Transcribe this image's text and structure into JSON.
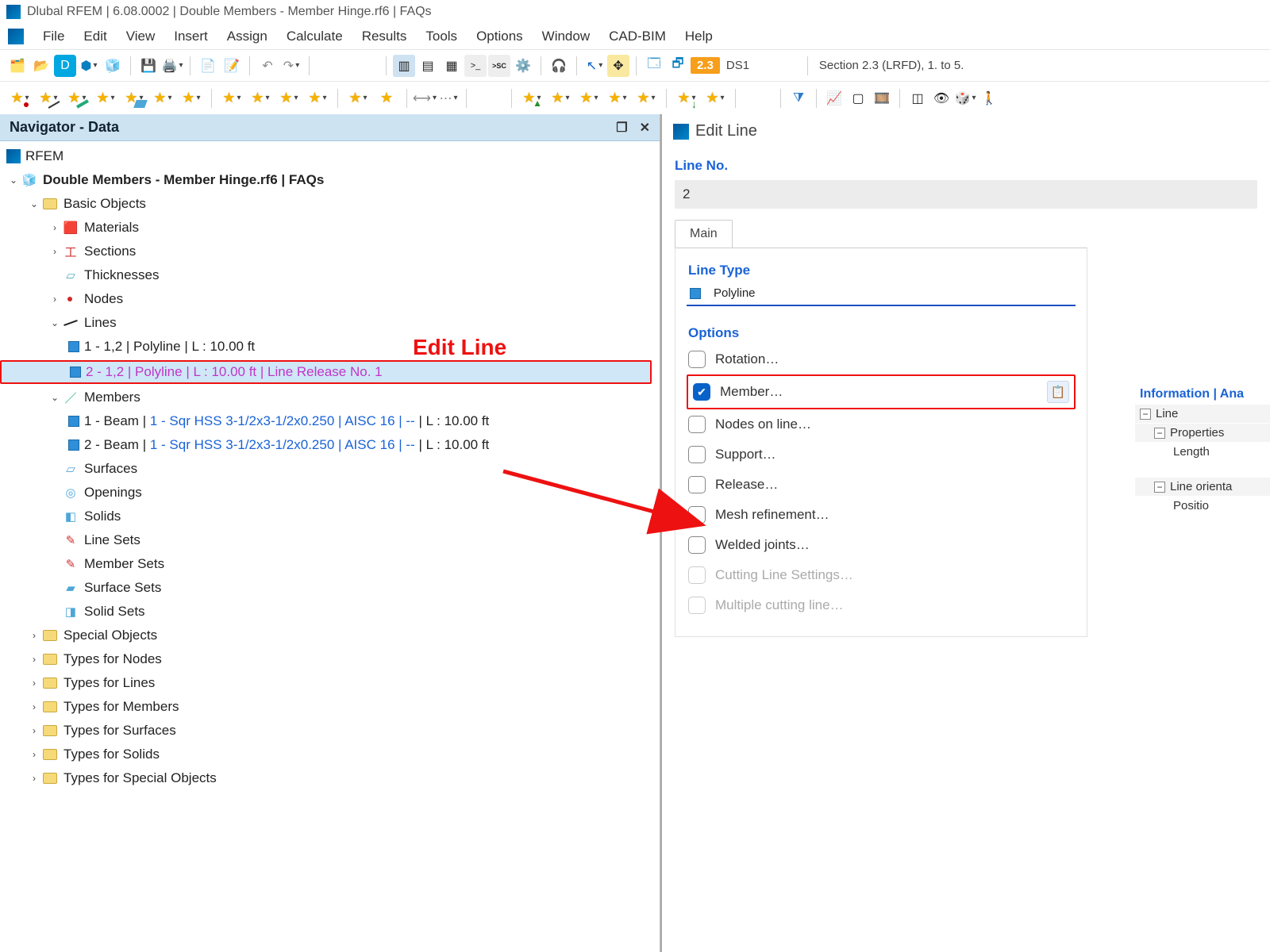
{
  "window": {
    "title": "Dlubal RFEM | 6.08.0002 | Double Members - Member Hinge.rf6 | FAQs"
  },
  "menu": {
    "items": [
      "File",
      "Edit",
      "View",
      "Insert",
      "Assign",
      "Calculate",
      "Results",
      "Tools",
      "Options",
      "Window",
      "CAD-BIM",
      "Help"
    ]
  },
  "toolbar": {
    "load_badge": "2.3",
    "load_combo": "DS1",
    "section_combo": "Section 2.3 (LRFD), 1. to 5."
  },
  "navigator": {
    "title": "Navigator - Data",
    "root": "RFEM",
    "project": "Double Members - Member Hinge.rf6 | FAQs",
    "basic_objects_label": "Basic Objects",
    "materials": "Materials",
    "sections": "Sections",
    "thicknesses": "Thicknesses",
    "nodes": "Nodes",
    "lines": "Lines",
    "line1": "1 - 1,2 | Polyline | L : 10.00 ft",
    "line2": "2 - 1,2 | Polyline | L : 10.00 ft | Line Release No. 1",
    "members": "Members",
    "member1_a": "1 - Beam | ",
    "member1_b": "1 - Sqr HSS 3-1/2x3-1/2x0.250 | AISC 16 | --",
    "member1_c": " | L : 10.00 ft",
    "member2_a": "2 - Beam | ",
    "member2_b": "1 - Sqr HSS 3-1/2x3-1/2x0.250 | AISC 16 | --",
    "member2_c": " | L : 10.00 ft",
    "surfaces": "Surfaces",
    "openings": "Openings",
    "solids": "Solids",
    "line_sets": "Line Sets",
    "member_sets": "Member Sets",
    "surface_sets": "Surface Sets",
    "solid_sets": "Solid Sets",
    "special_objects": "Special Objects",
    "types_nodes": "Types for Nodes",
    "types_lines": "Types for Lines",
    "types_members": "Types for Members",
    "types_surfaces": "Types for Surfaces",
    "types_solids": "Types for Solids",
    "types_special": "Types for Special Objects"
  },
  "annotation": {
    "label": "Edit Line"
  },
  "dialog": {
    "title": "Edit Line",
    "line_no_label": "Line No.",
    "line_no_value": "2",
    "tab_main": "Main",
    "line_type_label": "Line Type",
    "line_type_value": "Polyline",
    "options_label": "Options",
    "opt_rotation": "Rotation…",
    "opt_member": "Member…",
    "opt_nodes_on_line": "Nodes on line…",
    "opt_support": "Support…",
    "opt_release": "Release…",
    "opt_mesh": "Mesh refinement…",
    "opt_welded": "Welded joints…",
    "opt_cutting_settings": "Cutting Line Settings…",
    "opt_multiple_cutting": "Multiple cutting line…"
  },
  "info": {
    "header": "Information | Ana",
    "line": "Line",
    "properties": "Properties",
    "length": "Length",
    "orientation": "Line orienta",
    "position": "Positio"
  }
}
